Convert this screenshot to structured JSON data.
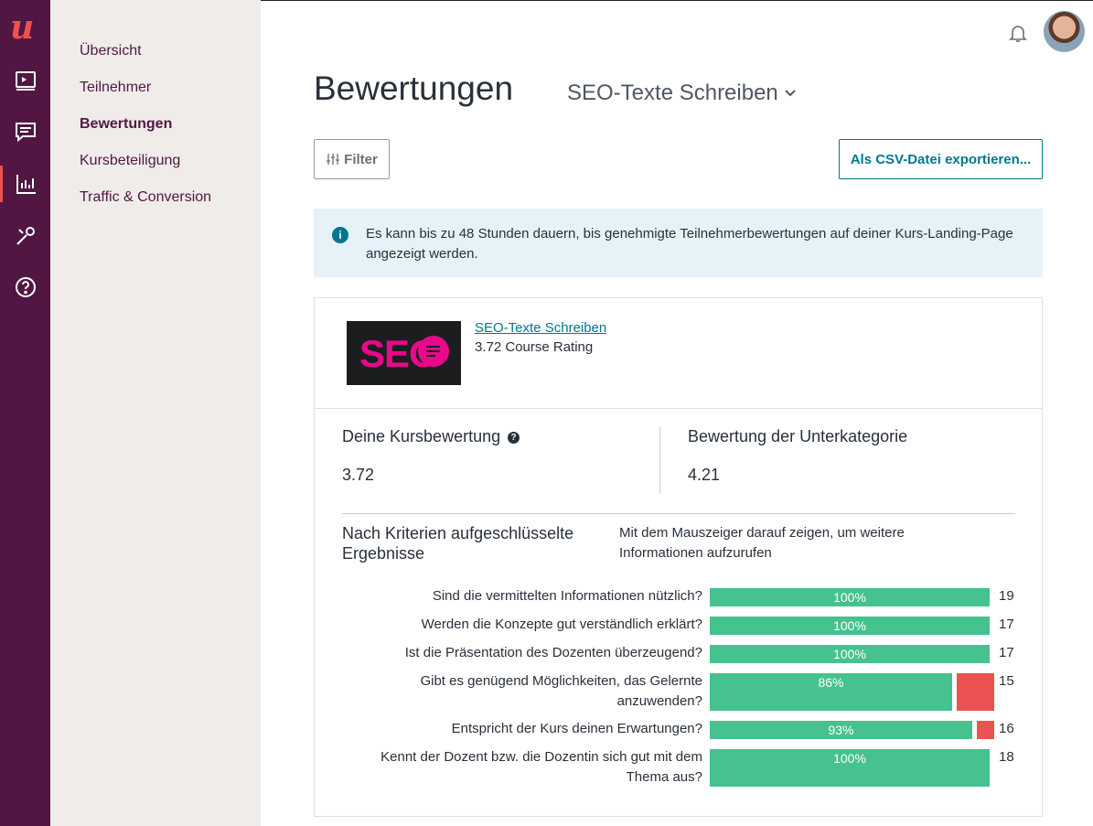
{
  "brand": {
    "logo_letter": "u",
    "accent": "#ec5252",
    "rail_color": "#511742"
  },
  "rail_icons": [
    "courses-icon",
    "messages-icon",
    "performance-icon",
    "tools-icon",
    "help-icon"
  ],
  "subnav": {
    "items": [
      {
        "label": "Übersicht",
        "active": false
      },
      {
        "label": "Teilnehmer",
        "active": false
      },
      {
        "label": "Bewertungen",
        "active": true
      },
      {
        "label": "Kursbeteiligung",
        "active": false
      },
      {
        "label": "Traffic & Conversion",
        "active": false
      }
    ]
  },
  "header": {
    "title": "Bewertungen",
    "course_select": "SEO-Texte Schreiben",
    "filter_label": "Filter",
    "export_label": "Als CSV-Datei exportieren..."
  },
  "info": {
    "text": "Es kann bis zu 48 Stunden dauern, bis genehmigte Teilnehmerbewertungen auf deiner Kurs-Landing-Page angezeigt werden."
  },
  "course": {
    "thumb_text": "SEO",
    "name": "SEO-Texte Schreiben",
    "rating_text": "3.72 Course Rating"
  },
  "ratings": {
    "own_label": "Deine Kursbewertung",
    "own_value": "3.72",
    "sub_label": "Bewertung der Unterkategorie",
    "sub_value": "4.21"
  },
  "criteria": {
    "title": "Nach Kriterien aufgeschlüsselte Ergebnisse",
    "hint": "Mit dem Mauszeiger darauf zeigen, um weitere Informationen aufzurufen",
    "rows": [
      {
        "question": "Sind die vermittelten Informationen nützlich?",
        "percent_label": "100%",
        "percent": 100,
        "count": "19"
      },
      {
        "question": "Werden die Konzepte gut verständlich erklärt?",
        "percent_label": "100%",
        "percent": 100,
        "count": "17"
      },
      {
        "question": "Ist die Präsentation des Dozenten überzeugend?",
        "percent_label": "100%",
        "percent": 100,
        "count": "17"
      },
      {
        "question": "Gibt es genügend Möglichkeiten, das Gelernte anzuwenden?",
        "percent_label": "86%",
        "percent": 86,
        "count": "15"
      },
      {
        "question": "Entspricht der Kurs deinen Erwartungen?",
        "percent_label": "93%",
        "percent": 93,
        "count": "16"
      },
      {
        "question": "Kennt der Dozent bzw. die Dozentin sich gut mit dem Thema aus?",
        "percent_label": "100%",
        "percent": 100,
        "count": "18"
      }
    ]
  }
}
